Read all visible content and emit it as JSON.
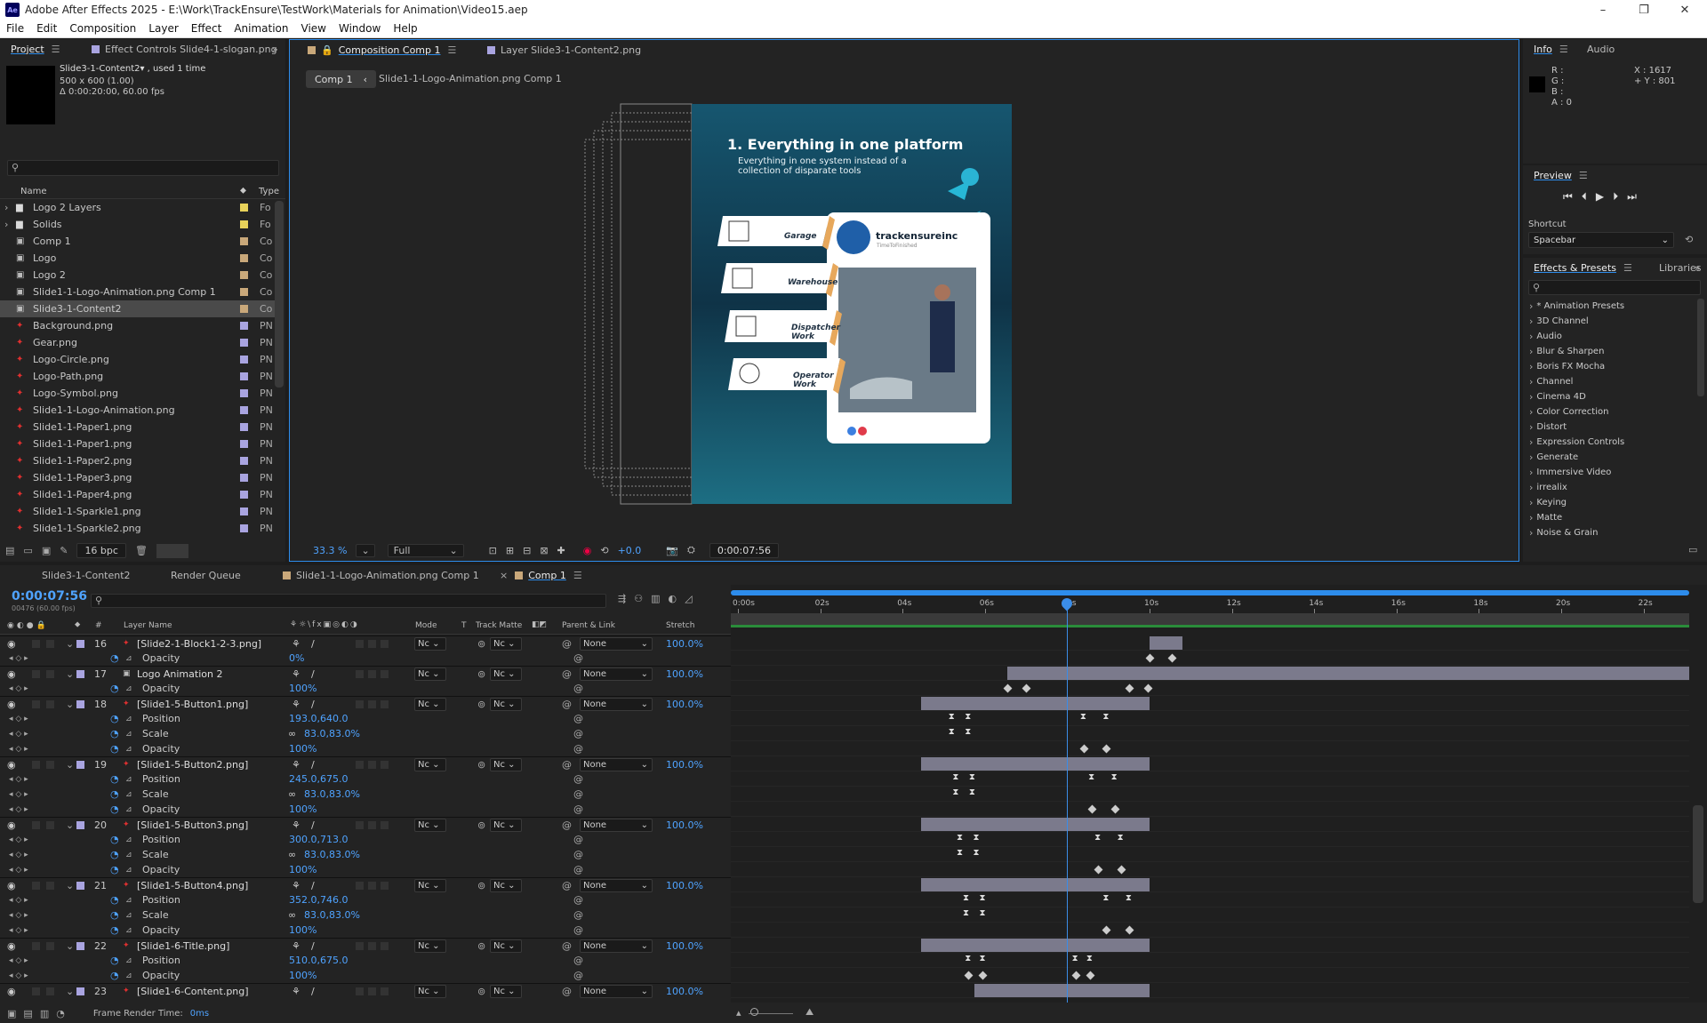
{
  "window": {
    "title": "Adobe After Effects 2025 - E:\\Work\\TrackEnsure\\TestWork\\Materials for Animation\\Video15.aep",
    "logo": "Ae",
    "min": "–",
    "max": "❐",
    "close": "✕"
  },
  "menu": [
    "File",
    "Edit",
    "Composition",
    "Layer",
    "Effect",
    "Animation",
    "View",
    "Window",
    "Help"
  ],
  "project": {
    "tab": "Project",
    "tab2": "Effect Controls Slide4-1-slogan.png",
    "info": {
      "name": "Slide3-1-Content2▾ , used 1 time",
      "dims": "500 x 600 (1.00)",
      "dur": "Δ 0:00:20:00, 60.00 fps"
    },
    "cols": {
      "name": "Name",
      "type": "Type"
    },
    "items": [
      {
        "name": "Logo 2 Layers",
        "type": "Fo",
        "kind": "folder",
        "label": "#e8d25a",
        "exp": true
      },
      {
        "name": "Solids",
        "type": "Fo",
        "kind": "folder",
        "label": "#e8d25a",
        "exp": true
      },
      {
        "name": "Comp 1",
        "type": "Co",
        "kind": "comp",
        "label": "#c9a87a"
      },
      {
        "name": "Logo",
        "type": "Co",
        "kind": "comp",
        "label": "#c9a87a"
      },
      {
        "name": "Logo 2",
        "type": "Co",
        "kind": "comp",
        "label": "#c9a87a"
      },
      {
        "name": "Slide1-1-Logo-Animation.png Comp 1",
        "type": "Co",
        "kind": "comp",
        "label": "#c9a87a"
      },
      {
        "name": "Slide3-1-Content2",
        "type": "Co",
        "kind": "comp",
        "label": "#c9a87a",
        "sel": true
      },
      {
        "name": "Background.png",
        "type": "PN",
        "kind": "png",
        "label": "#a9a4e0"
      },
      {
        "name": "Gear.png",
        "type": "PN",
        "kind": "png",
        "label": "#a9a4e0"
      },
      {
        "name": "Logo-Circle.png",
        "type": "PN",
        "kind": "png",
        "label": "#a9a4e0"
      },
      {
        "name": "Logo-Path.png",
        "type": "PN",
        "kind": "png",
        "label": "#a9a4e0"
      },
      {
        "name": "Logo-Symbol.png",
        "type": "PN",
        "kind": "png",
        "label": "#a9a4e0"
      },
      {
        "name": "Slide1-1-Logo-Animation.png",
        "type": "PN",
        "kind": "png",
        "label": "#a9a4e0"
      },
      {
        "name": "Slide1-1-Paper1.png",
        "type": "PN",
        "kind": "png",
        "label": "#a9a4e0"
      },
      {
        "name": "Slide1-1-Paper1.png",
        "type": "PN",
        "kind": "png",
        "label": "#a9a4e0"
      },
      {
        "name": "Slide1-1-Paper2.png",
        "type": "PN",
        "kind": "png",
        "label": "#a9a4e0"
      },
      {
        "name": "Slide1-1-Paper3.png",
        "type": "PN",
        "kind": "png",
        "label": "#a9a4e0"
      },
      {
        "name": "Slide1-1-Paper4.png",
        "type": "PN",
        "kind": "png",
        "label": "#a9a4e0"
      },
      {
        "name": "Slide1-1-Sparkle1.png",
        "type": "PN",
        "kind": "png",
        "label": "#a9a4e0"
      },
      {
        "name": "Slide1-1-Sparkle2.png",
        "type": "PN",
        "kind": "png",
        "label": "#a9a4e0"
      }
    ],
    "bpc": "16 bpc"
  },
  "comp": {
    "tab": "Composition Comp 1",
    "tab2": "Layer Slide3-1-Content2.png",
    "crumb1": "Comp 1",
    "crumb2": "Slide1-1-Logo-Animation.png Comp 1",
    "zoom": "33.3 %",
    "res": "Full",
    "exposure": "+0.0",
    "time": "0:00:07:56"
  },
  "slide": {
    "title": "1. Everything in one platform",
    "subtitle": "Everything in one system instead of a collection of disparate tools",
    "buttons": [
      "Garage",
      "Warehouse",
      "Dispatcher Work",
      "Operator Work"
    ],
    "card_name": "trackensureinc",
    "card_sub": "TimeToFinished"
  },
  "info": {
    "tab": "Info",
    "tab2": "Audio",
    "r": "R :",
    "g": "G :",
    "b": "B :",
    "a": "A :  0",
    "x": "X : 1617",
    "y": "+ Y : 801"
  },
  "preview": {
    "tab": "Preview",
    "shortcut_label": "Shortcut",
    "shortcut": "Spacebar"
  },
  "effects": {
    "tab": "Effects & Presets",
    "tab2": "Libraries",
    "items": [
      "* Animation Presets",
      "3D Channel",
      "Audio",
      "Blur & Sharpen",
      "Boris FX Mocha",
      "Channel",
      "Cinema 4D",
      "Color Correction",
      "Distort",
      "Expression Controls",
      "Generate",
      "Immersive Video",
      "irrealix",
      "Keying",
      "Matte",
      "Noise & Grain"
    ]
  },
  "timeline": {
    "tabs": [
      "Slide3-1-Content2",
      "Render Queue",
      "Slide1-1-Logo-Animation.png Comp 1",
      "Comp 1"
    ],
    "time": "0:00:07:56",
    "frames": "00476 (60.00 fps)",
    "cols": {
      "num": "#",
      "layer": "Layer Name",
      "mode": "Mode",
      "t": "T",
      "track": "Track Matte",
      "parent": "Parent & Link",
      "stretch": "Stretch"
    },
    "ruler": [
      "0:00s",
      "02s",
      "04s",
      "06s",
      "08s",
      "10s",
      "12s",
      "14s",
      "16s",
      "18s",
      "20s",
      "22s"
    ],
    "rows": [
      {
        "t": "L",
        "num": "16",
        "name": "[Slide2-1-Block1-2-3.png]",
        "mode": "Nc",
        "tm": "Nc",
        "parent": "None",
        "stretch": "100.0%",
        "bar": [
          10,
          10.8
        ]
      },
      {
        "t": "P",
        "name": "Opacity",
        "val": "0%",
        "kf": [
          [
            10,
            "d"
          ],
          [
            10.55,
            "d"
          ]
        ]
      },
      {
        "t": "L",
        "num": "17",
        "name": "Logo Animation 2",
        "mode": "Nc",
        "tm": "Nc",
        "parent": "None",
        "stretch": "100.0%",
        "comp": true,
        "bar": [
          6.55,
          23.3
        ]
      },
      {
        "t": "P",
        "name": "Opacity",
        "val": "100%",
        "kf": [
          [
            6.55,
            "d"
          ],
          [
            7.0,
            "d"
          ],
          [
            9.5,
            "d"
          ],
          [
            9.95,
            "d"
          ]
        ]
      },
      {
        "t": "L",
        "num": "18",
        "name": "[Slide1-5-Button1.png]",
        "mode": "Nc",
        "tm": "Nc",
        "parent": "None",
        "stretch": "100.0%",
        "bar": [
          4.45,
          10
        ]
      },
      {
        "t": "P",
        "name": "Position",
        "val": "193.0,640.0",
        "kf": [
          [
            5.2,
            "h"
          ],
          [
            5.6,
            "h"
          ],
          [
            8.4,
            "h"
          ],
          [
            8.95,
            "h"
          ]
        ]
      },
      {
        "t": "P",
        "name": "Scale",
        "val": "83.0,83.0%",
        "link": true,
        "kf": [
          [
            5.2,
            "h"
          ],
          [
            5.6,
            "h"
          ]
        ]
      },
      {
        "t": "P",
        "name": "Opacity",
        "val": "100%",
        "kf": [
          [
            8.4,
            "d"
          ],
          [
            8.95,
            "d"
          ]
        ]
      },
      {
        "t": "L",
        "num": "19",
        "name": "[Slide1-5-Button2.png]",
        "mode": "Nc",
        "tm": "Nc",
        "parent": "None",
        "stretch": "100.0%",
        "bar": [
          4.45,
          10
        ]
      },
      {
        "t": "P",
        "name": "Position",
        "val": "245.0,675.0",
        "kf": [
          [
            5.3,
            "h"
          ],
          [
            5.7,
            "h"
          ],
          [
            8.6,
            "h"
          ],
          [
            9.15,
            "h"
          ]
        ]
      },
      {
        "t": "P",
        "name": "Scale",
        "val": "83.0,83.0%",
        "link": true,
        "kf": [
          [
            5.3,
            "h"
          ],
          [
            5.7,
            "h"
          ]
        ]
      },
      {
        "t": "P",
        "name": "Opacity",
        "val": "100%",
        "kf": [
          [
            8.6,
            "d"
          ],
          [
            9.15,
            "d"
          ]
        ]
      },
      {
        "t": "L",
        "num": "20",
        "name": "[Slide1-5-Button3.png]",
        "mode": "Nc",
        "tm": "Nc",
        "parent": "None",
        "stretch": "100.0%",
        "bar": [
          4.45,
          10
        ]
      },
      {
        "t": "P",
        "name": "Position",
        "val": "300.0,713.0",
        "kf": [
          [
            5.4,
            "h"
          ],
          [
            5.8,
            "h"
          ],
          [
            8.75,
            "h"
          ],
          [
            9.3,
            "h"
          ]
        ]
      },
      {
        "t": "P",
        "name": "Scale",
        "val": "83.0,83.0%",
        "link": true,
        "kf": [
          [
            5.4,
            "h"
          ],
          [
            5.8,
            "h"
          ]
        ]
      },
      {
        "t": "P",
        "name": "Opacity",
        "val": "100%",
        "kf": [
          [
            8.75,
            "d"
          ],
          [
            9.3,
            "d"
          ]
        ]
      },
      {
        "t": "L",
        "num": "21",
        "name": "[Slide1-5-Button4.png]",
        "mode": "Nc",
        "tm": "Nc",
        "parent": "None",
        "stretch": "100.0%",
        "bar": [
          4.45,
          10
        ]
      },
      {
        "t": "P",
        "name": "Position",
        "val": "352.0,746.0",
        "kf": [
          [
            5.55,
            "h"
          ],
          [
            5.95,
            "h"
          ],
          [
            8.95,
            "h"
          ],
          [
            9.5,
            "h"
          ]
        ]
      },
      {
        "t": "P",
        "name": "Scale",
        "val": "83.0,83.0%",
        "link": true,
        "kf": [
          [
            5.55,
            "h"
          ],
          [
            5.95,
            "h"
          ]
        ]
      },
      {
        "t": "P",
        "name": "Opacity",
        "val": "100%",
        "kf": [
          [
            8.95,
            "d"
          ],
          [
            9.5,
            "d"
          ]
        ]
      },
      {
        "t": "L",
        "num": "22",
        "name": "[Slide1-6-Title.png]",
        "mode": "Nc",
        "tm": "Nc",
        "parent": "None",
        "stretch": "100.0%",
        "bar": [
          4.45,
          10
        ]
      },
      {
        "t": "P",
        "name": "Position",
        "val": "510.0,675.0",
        "kf": [
          [
            5.6,
            "h"
          ],
          [
            5.95,
            "h"
          ],
          [
            8.2,
            "h"
          ],
          [
            8.55,
            "h"
          ]
        ]
      },
      {
        "t": "P",
        "name": "Opacity",
        "val": "100%",
        "kf": [
          [
            5.6,
            "d"
          ],
          [
            5.95,
            "d"
          ],
          [
            8.2,
            "d"
          ],
          [
            8.55,
            "d"
          ]
        ]
      },
      {
        "t": "L",
        "num": "23",
        "name": "[Slide1-6-Content.png]",
        "mode": "Nc",
        "tm": "Nc",
        "parent": "None",
        "stretch": "100.0%",
        "bar": [
          5.75,
          10
        ]
      }
    ],
    "playhead": 8.0,
    "footer": "Frame Render Time:",
    "footer_val": "0ms"
  },
  "colors": {
    "accent": "#2d8ceb",
    "panel": "#232323",
    "bar": "#7b7a8c",
    "slide_bg": "#134a63"
  }
}
